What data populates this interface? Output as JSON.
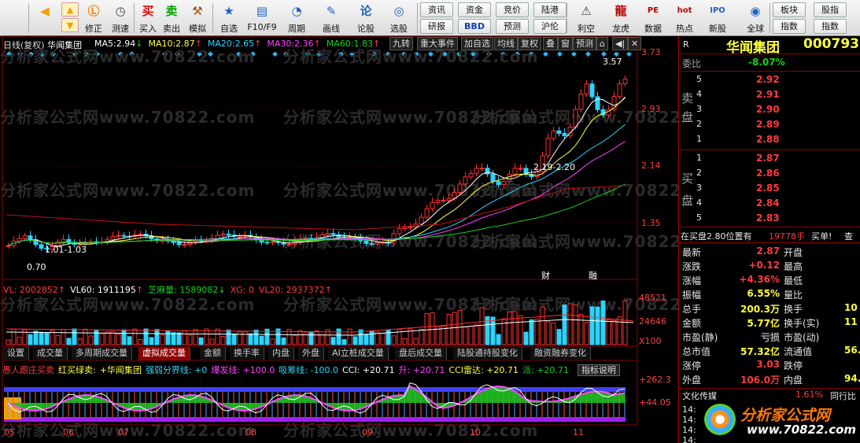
{
  "toolbar": {
    "buttons": [
      {
        "id": "back",
        "label": "",
        "icon": "◀",
        "color": "#f0a000"
      },
      {
        "id": "up",
        "label": "修正",
        "icon": "▲",
        "color": "#f0a000"
      },
      {
        "id": "down",
        "label": "",
        "icon": "▼",
        "color": "#f0a000"
      },
      {
        "id": "repair",
        "label": "修正",
        "icon": "Ⓛ",
        "color": "#f08000"
      },
      {
        "id": "test",
        "label": "测速",
        "icon": "◷",
        "color": "#444"
      },
      {
        "id": "buy",
        "label": "买入",
        "icon": "买",
        "color": "#e00000"
      },
      {
        "id": "sell",
        "label": "卖出",
        "icon": "卖",
        "color": "#00a000"
      },
      {
        "id": "sim",
        "label": "模拟",
        "icon": "⚒",
        "color": "#a05000"
      },
      {
        "id": "fav",
        "label": "自选",
        "icon": "★",
        "color": "#2060c0"
      },
      {
        "id": "f10",
        "label": "F10/F9",
        "icon": "▤",
        "color": "#2060c0"
      },
      {
        "id": "period",
        "label": "周期",
        "icon": "◔",
        "color": "#2060c0"
      },
      {
        "id": "draw",
        "label": "画线",
        "icon": "✎",
        "color": "#2060c0"
      },
      {
        "id": "theory",
        "label": "论股",
        "icon": "论",
        "color": "#2060c0"
      },
      {
        "id": "pick",
        "label": "选股",
        "icon": "◎",
        "color": "#2060c0"
      },
      {
        "id": "warn",
        "label": "利空",
        "icon": "⚠",
        "color": "#444"
      },
      {
        "id": "dragon",
        "label": "龙虎",
        "icon": "龍",
        "color": "#c00000"
      },
      {
        "id": "data",
        "label": "数据",
        "icon": "PE",
        "color": "#c00000"
      },
      {
        "id": "hot",
        "label": "热点",
        "icon": "hot",
        "color": "#c00000"
      },
      {
        "id": "ipo",
        "label": "新股",
        "icon": "IPO",
        "color": "#2060c0"
      },
      {
        "id": "globe",
        "label": "全球",
        "icon": "◉",
        "color": "#2060c0"
      }
    ],
    "small": [
      {
        "label": "资讯",
        "blue": false
      },
      {
        "label": "研报",
        "blue": false
      },
      {
        "label": "资金",
        "blue": false
      },
      {
        "label": "BBD",
        "blue": true
      },
      {
        "label": "竞价",
        "blue": false
      },
      {
        "label": "预测",
        "blue": false
      },
      {
        "label": "陆港",
        "blue": false
      },
      {
        "label": "沪伦",
        "blue": false
      },
      {
        "label": "板块",
        "blue": false
      },
      {
        "label": "指数",
        "blue": false
      },
      {
        "label": "股指",
        "blue": false
      },
      {
        "label": "指数",
        "blue": false
      }
    ]
  },
  "chart": {
    "title": "日线(复权)",
    "stock_name": "华闻集团",
    "ma": [
      {
        "label": "MA5:",
        "value": "2.94",
        "arrow": "↓",
        "color": "#ffffff"
      },
      {
        "label": "MA10:",
        "value": "2.87",
        "arrow": "↑",
        "color": "#ffff40"
      },
      {
        "label": "MA20:",
        "value": "2.65",
        "arrow": "↑",
        "color": "#2ad4ff"
      },
      {
        "label": "MA30:",
        "value": "2.36",
        "arrow": "↑",
        "color": "#ff44ff"
      },
      {
        "label": "MA60:",
        "value": "1.83",
        "arrow": "↑",
        "color": "#18d018"
      }
    ],
    "buttons": [
      "九转",
      "重大事件",
      "加自选",
      "均线",
      "复权",
      "叠",
      "窗",
      "预测"
    ],
    "price_axis": [
      "3.73",
      "2.93",
      "2.14",
      "1.35"
    ],
    "annotations": {
      "high": "3.57",
      "low": "0.70",
      "range": "1.01-1.03",
      "mid": "2.19-2.20",
      "cai": "财",
      "rong": "融"
    },
    "volume": {
      "vl": "VL: 2002852",
      "vl_arrow": "↑",
      "vl60": "VL60: 1911195",
      "vl60_arrow": "↑",
      "zhima": "芝麻量: 1589082",
      "zhima_arrow": "↓",
      "xg": "XG: 0",
      "vl20": "VL20: 2937372",
      "vl20_arrow": "↑",
      "axis": [
        "48521",
        "24646",
        "X100"
      ]
    },
    "tabs": [
      "设置",
      "成交量",
      "多周期成交量",
      "虚拟成交量",
      "金额",
      "换手率",
      "内盘",
      "外盘",
      "AI立桩成交量",
      "盘后成交量",
      "陆股通持股变化",
      "融资融券变化"
    ],
    "active_tab": "虚拟成交量",
    "indicator": {
      "name": "愚人跟庄买卖",
      "desc": "红买绿卖:",
      "stock": "+华闻集团",
      "qiangruo": "强弱分界线: +0",
      "baofa": "爆发线: +100.0",
      "xichou": "吸筹线: -100.0",
      "cci": "CCI: +20.71",
      "sheng": "升: +20.71",
      "cci_radar": "CCI雷达: +20.71",
      "pai": "派: +20.71",
      "btn": "指标说明",
      "axis": [
        "+262.3",
        "+44.05"
      ]
    },
    "dates": [
      "05",
      "06",
      "07",
      "08",
      "09",
      "10",
      "11"
    ]
  },
  "quote": {
    "r_label": "R",
    "name": "华闻集团",
    "code": "000793",
    "weibi_label": "委比",
    "weibi": "-8.07%",
    "sell_label1": "卖",
    "sell_label2": "盘",
    "buy_label1": "买",
    "buy_label2": "盘",
    "sells": [
      {
        "n": "5",
        "p": "2.92"
      },
      {
        "n": "4",
        "p": "2.91"
      },
      {
        "n": "3",
        "p": "2.90"
      },
      {
        "n": "2",
        "p": "2.89"
      },
      {
        "n": "1",
        "p": "2.88"
      }
    ],
    "buys": [
      {
        "n": "1",
        "p": "2.87"
      },
      {
        "n": "2",
        "p": "2.86"
      },
      {
        "n": "3",
        "p": "2.85"
      },
      {
        "n": "4",
        "p": "2.84"
      },
      {
        "n": "5",
        "p": "2.83"
      }
    ],
    "status": "在买盘2.80位置有",
    "status_qty": "19778手",
    "status_end": "买单!",
    "status_q": "查",
    "stats": [
      {
        "l": "最新",
        "v": "2.87",
        "vc": "red",
        "l2": "开盘"
      },
      {
        "l": "涨跌",
        "v": "+0.12",
        "vc": "red",
        "l2": "最高"
      },
      {
        "l": "涨幅",
        "v": "+4.36%",
        "vc": "red",
        "l2": "最低"
      },
      {
        "l": "振幅",
        "v": "6.55%",
        "vc": "yellow",
        "l2": "量比"
      },
      {
        "l": "总手",
        "v": "200.3万",
        "vc": "yellow",
        "l2": "换手",
        "r": "10"
      },
      {
        "l": "金额",
        "v": "5.77亿",
        "vc": "yellow",
        "l2": "换手(实)",
        "r": "11"
      },
      {
        "l": "市盈(静)",
        "v": "亏损",
        "vc": "gray",
        "l2": "市盈(动)"
      },
      {
        "l": "总市值",
        "v": "57.32亿",
        "vc": "yellow",
        "l2": "流通值",
        "r": "56."
      },
      {
        "l": "涨停",
        "v": "3.03",
        "vc": "red",
        "l2": "跌停"
      },
      {
        "l": "外盘",
        "v": "106.0万",
        "vc": "red",
        "l2": "内盘",
        "r": "94."
      }
    ],
    "bottom": [
      {
        "l": "文化传媒",
        "v": "1.61%",
        "l2": "同行比"
      }
    ],
    "times": [
      "14:",
      "14:",
      "14:",
      "14:"
    ]
  },
  "brand": {
    "text": "分析家公式网",
    "url": "www.70822.com"
  },
  "watermark": "分析家公式网www.70822.com"
}
